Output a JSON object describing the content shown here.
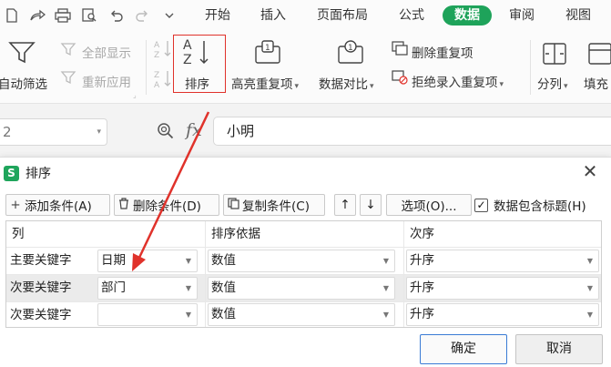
{
  "ribbon_tabs": [
    {
      "label": "开始",
      "active": false
    },
    {
      "label": "插入",
      "active": false
    },
    {
      "label": "页面布局",
      "active": false
    },
    {
      "label": "公式",
      "active": false
    },
    {
      "label": "数据",
      "active": true
    },
    {
      "label": "审阅",
      "active": false
    },
    {
      "label": "视图",
      "active": false
    }
  ],
  "ribbon": {
    "auto_filter": "自动筛选",
    "show_all": "全部显示",
    "reapply": "重新应用",
    "sort": "排序",
    "highlight_dup": "高亮重复项",
    "compare": "数据对比",
    "remove_dup": "删除重复项",
    "reject_dup": "拒绝录入重复项",
    "split_col": "分列",
    "fill": "填充"
  },
  "formula_bar": {
    "name_box": "2",
    "fx": "fx",
    "value": "小明"
  },
  "dialog": {
    "title": "排序",
    "icon_letter": "S",
    "toolbar": {
      "add": "添加条件(A)",
      "delete": "删除条件(D)",
      "copy": "复制条件(C)",
      "options": "选项(O)...",
      "has_header": "数据包含标题(H)",
      "has_header_checked": true
    },
    "columns": [
      "列",
      "排序依据",
      "次序"
    ],
    "rows": [
      {
        "label": "主要关键字",
        "key": "日期",
        "basis": "数值",
        "order": "升序"
      },
      {
        "label": "次要关键字",
        "key": "部门",
        "basis": "数值",
        "order": "升序"
      },
      {
        "label": "次要关键字",
        "key": "",
        "basis": "数值",
        "order": "升序"
      }
    ],
    "ok": "确定",
    "cancel": "取消"
  },
  "colors": {
    "active_tab": "#1ea35a",
    "highlight_box": "#e0322b",
    "arrow": "#e0322b",
    "ok_border": "#3a7bd5"
  }
}
